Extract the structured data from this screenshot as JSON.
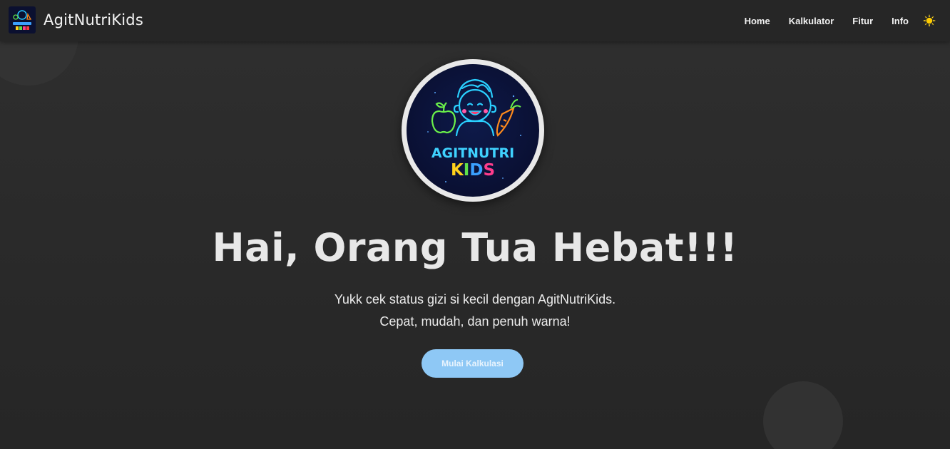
{
  "nav": {
    "brand_name": "AgitNutriKids",
    "links": [
      {
        "label": "Home"
      },
      {
        "label": "Kalkulator"
      },
      {
        "label": "Fitur"
      },
      {
        "label": "Info"
      }
    ],
    "theme_icon": "sun-icon"
  },
  "hero": {
    "logo_text_line1": "AGITNUTRI",
    "logo_text_line2": "KIDS",
    "title": "Hai, Orang Tua Hebat!!!",
    "subtitle_line1": "Yukk cek status gizi si kecil dengan AgitNutriKids.",
    "subtitle_line2": "Cepat, mudah, dan penuh warna!",
    "cta_label": "Mulai Kalkulasi"
  },
  "colors": {
    "background": "#2b2b2b",
    "navbar": "#262626",
    "cta": "#8ec8f5",
    "logo_bg": "#0a1033"
  }
}
